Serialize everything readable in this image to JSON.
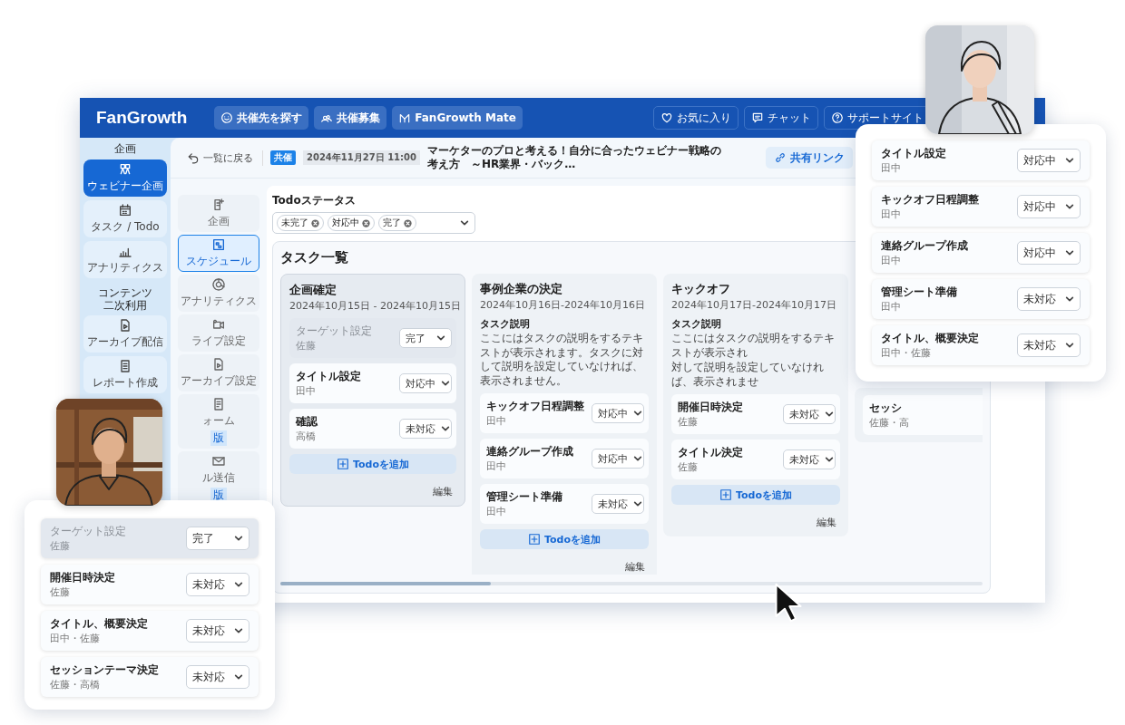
{
  "topbar": {
    "logo": "FanGrowth",
    "nav_buttons": [
      "共催先を探す",
      "共催募集",
      "FanGrowth Mate"
    ],
    "utility_buttons": [
      "お気に入り",
      "チャット",
      "サポートサイト"
    ]
  },
  "sidebar": [
    {
      "heading": "企画",
      "items": [
        {
          "label": "ウェビナー企画",
          "selected": true
        },
        {
          "label": "タスク / Todo",
          "selected": false
        },
        {
          "label": "アナリティクス",
          "selected": false
        }
      ]
    },
    {
      "heading_lines": [
        "コンテンツ",
        "二次利用"
      ],
      "items": [
        {
          "label": "アーカイブ配信",
          "selected": false
        },
        {
          "label": "レポート作成",
          "selected": false
        }
      ]
    }
  ],
  "event_header": {
    "back": "一覧に戻る",
    "badge": "共催",
    "date": "2024年11月27日 11:00",
    "title": "マーケターのプロと考える！自分に合ったウェビナー戦略の考え方　～HR業界・バック…",
    "share": "共有リンク"
  },
  "sub_nav": [
    {
      "label": "企画",
      "selected": false
    },
    {
      "label": "スケジュール",
      "selected": true
    },
    {
      "label": "アナリティクス",
      "selected": false
    },
    {
      "label": "ライブ設定",
      "selected": false
    },
    {
      "label": "アーカイブ設定",
      "selected": false
    },
    {
      "label": "ォーム",
      "badge": "版",
      "selected": false
    },
    {
      "label": "ル送信",
      "badge": "版",
      "selected": false
    }
  ],
  "filter": {
    "label": "Todoステータス",
    "chips": [
      "未完了",
      "対応中",
      "完了"
    ]
  },
  "board": {
    "title": "タスク一覧",
    "columns": [
      {
        "title": "企画確定",
        "dates": "2024年10月15日 - 2024年10月15日",
        "tasks": [
          {
            "name": "ターゲット設定",
            "assignee": "佐藤",
            "status": "完了",
            "done": true
          },
          {
            "name": "タイトル設定",
            "assignee": "田中",
            "status": "対応中",
            "done": false
          },
          {
            "name": "確認",
            "assignee": "高橋",
            "status": "未対応",
            "done": false
          }
        ],
        "add_button": "Todoを追加",
        "edit": "編集"
      },
      {
        "title": "事例企業の決定",
        "dates": "2024年10月16日-2024年10月16日",
        "description_label": "タスク説明",
        "description_lines": [
          "ここにはタスクの説明をするテキストが表示されます。タスクに対して説明を設定していなければ、表示されません。"
        ],
        "tasks": [
          {
            "name": "キックオフ日程調整",
            "assignee": "田中",
            "status": "対応中",
            "done": false
          },
          {
            "name": "連絡グループ作成",
            "assignee": "田中",
            "status": "対応中",
            "done": false
          },
          {
            "name": "管理シート準備",
            "assignee": "田中",
            "status": "未対応",
            "done": false
          }
        ],
        "add_button": "Todoを追加",
        "edit": "編集"
      },
      {
        "title": "キックオフ",
        "dates": "2024年10月17日-2024年10月17日",
        "description_label": "タスク説明",
        "description_lines": [
          "ここにはタスクの説明をするテキストが表示され",
          "対して説明を設定していなければ、表示されませ"
        ],
        "tasks": [
          {
            "name": "開催日時決定",
            "assignee": "佐藤",
            "status": "未対応",
            "done": false
          },
          {
            "name": "タイトル決定",
            "assignee": "佐藤",
            "status": "未対応",
            "done": false
          }
        ],
        "add_button": "Todoを追加",
        "edit": "編集"
      },
      {
        "tasks": [
          {
            "name": "セッシ",
            "assignee": "佐藤・高",
            "done": false
          }
        ]
      }
    ]
  },
  "left_popup": {
    "tasks": [
      {
        "name": "ターゲット設定",
        "assignee": "佐藤",
        "status": "完了",
        "done": true
      },
      {
        "name": "開催日時決定",
        "assignee": "佐藤",
        "status": "未対応",
        "done": false
      },
      {
        "name": "タイトル、概要決定",
        "assignee": "田中・佐藤",
        "status": "未対応",
        "done": false
      },
      {
        "name": "セッションテーマ決定",
        "assignee": "佐藤・高橋",
        "status": "未対応",
        "done": false
      }
    ]
  },
  "right_popup": {
    "tasks": [
      {
        "name": "タイトル設定",
        "assignee": "田中",
        "status": "対応中",
        "done": false
      },
      {
        "name": "キックオフ日程調整",
        "assignee": "田中",
        "status": "対応中",
        "done": false
      },
      {
        "name": "連絡グループ作成",
        "assignee": "田中",
        "status": "対応中",
        "done": false
      },
      {
        "name": "管理シート準備",
        "assignee": "田中",
        "status": "未対応",
        "done": false
      },
      {
        "name": "タイトル、概要決定",
        "assignee": "田中・佐藤",
        "status": "未対応",
        "done": false
      }
    ]
  }
}
